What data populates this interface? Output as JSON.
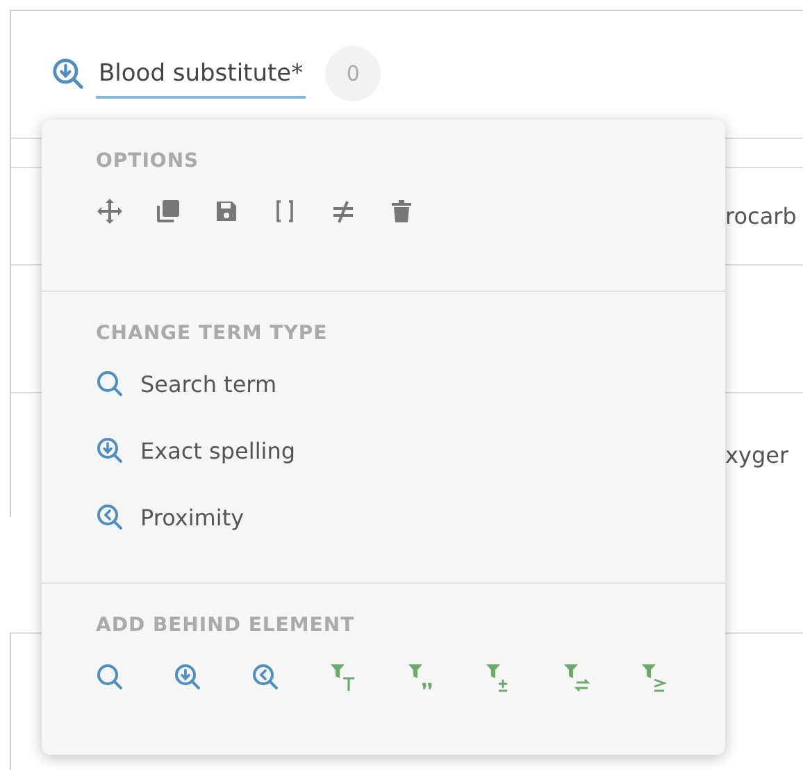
{
  "search_term": {
    "kind": "exact",
    "text": "Blood substitute*",
    "count": "0"
  },
  "background_rows": [
    {},
    {
      "text": "rocarb"
    },
    {},
    {
      "text": "xyger"
    }
  ],
  "menu": {
    "options_title": "OPTIONS",
    "change_title": "CHANGE TERM TYPE",
    "term_types": [
      {
        "label": "Search term",
        "kind": "search"
      },
      {
        "label": "Exact spelling",
        "kind": "exact"
      },
      {
        "label": "Proximity",
        "kind": "proximity"
      }
    ],
    "add_title": "ADD BEHIND ELEMENT"
  }
}
